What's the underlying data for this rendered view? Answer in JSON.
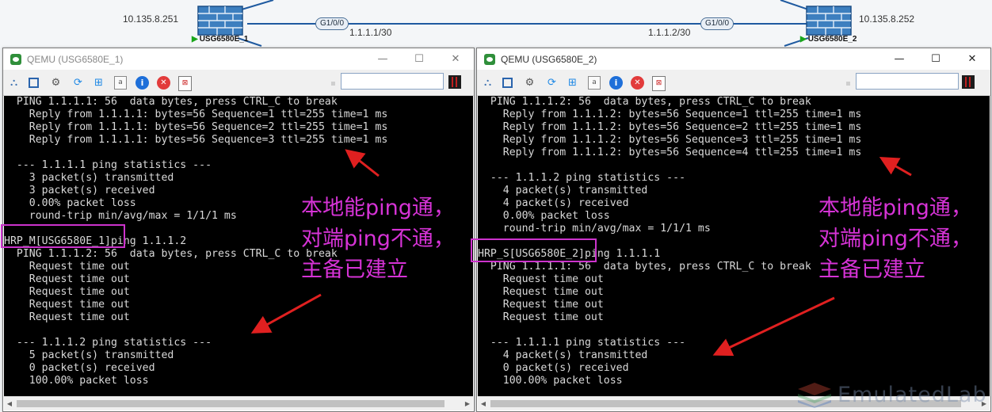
{
  "topology": {
    "ip_left": "10.135.8.251",
    "ip_right": "10.135.8.252",
    "iface_left": "G1/0/0",
    "iface_right": "G1/0/0",
    "subnet_left": "1.1.1.1/30",
    "subnet_right": "1.1.1.2/30",
    "device_left": "USG6580E_1",
    "device_right": "USG6580E_2"
  },
  "windows": [
    {
      "title": "QEMU (USG6580E_1)",
      "console_lines": [
        "  PING 1.1.1.1: 56  data bytes, press CTRL_C to break",
        "    Reply from 1.1.1.1: bytes=56 Sequence=1 ttl=255 time=1 ms",
        "    Reply from 1.1.1.1: bytes=56 Sequence=2 ttl=255 time=1 ms",
        "    Reply from 1.1.1.1: bytes=56 Sequence=3 ttl=255 time=1 ms",
        "",
        "  --- 1.1.1.1 ping statistics ---",
        "    3 packet(s) transmitted",
        "    3 packet(s) received",
        "    0.00% packet loss",
        "    round-trip min/avg/max = 1/1/1 ms",
        "",
        "HRP_M[USG6580E_1]ping 1.1.1.2",
        "  PING 1.1.1.2: 56  data bytes, press CTRL_C to break",
        "    Request time out",
        "    Request time out",
        "    Request time out",
        "    Request time out",
        "    Request time out",
        "",
        "  --- 1.1.1.2 ping statistics ---",
        "    5 packet(s) transmitted",
        "    0 packet(s) received",
        "    100.00% packet loss"
      ],
      "annotation": [
        "本地能ping通，",
        "对端ping不通，",
        "主备已建立"
      ]
    },
    {
      "title": "QEMU (USG6580E_2)",
      "console_lines": [
        "  PING 1.1.1.2: 56  data bytes, press CTRL_C to break",
        "    Reply from 1.1.1.2: bytes=56 Sequence=1 ttl=255 time=1 ms",
        "    Reply from 1.1.1.2: bytes=56 Sequence=2 ttl=255 time=1 ms",
        "    Reply from 1.1.1.2: bytes=56 Sequence=3 ttl=255 time=1 ms",
        "    Reply from 1.1.1.2: bytes=56 Sequence=4 ttl=255 time=1 ms",
        "",
        "  --- 1.1.1.2 ping statistics ---",
        "    4 packet(s) transmitted",
        "    4 packet(s) received",
        "    0.00% packet loss",
        "    round-trip min/avg/max = 1/1/1 ms",
        "",
        "HRP_S[USG6580E_2]ping 1.1.1.1",
        "  PING 1.1.1.1: 56  data bytes, press CTRL_C to break",
        "    Request time out",
        "    Request time out",
        "    Request time out",
        "    Request time out",
        "",
        "  --- 1.1.1.1 ping statistics ---",
        "    4 packet(s) transmitted",
        "    0 packet(s) received",
        "    100.00% packet loss"
      ],
      "annotation": [
        "本地能ping通，",
        "对端ping不通，",
        "主备已建立"
      ]
    }
  ],
  "window_controls": {
    "minimize": "—",
    "maximize": "☐",
    "close": "✕"
  },
  "toolbar_icons": [
    "network-icon",
    "fullscreen-icon",
    "settings-icon",
    "refresh-icon",
    "windows-icon",
    "text-icon",
    "info-icon",
    "stop-icon",
    "disk-icon"
  ],
  "watermark": "EmulatedLab"
}
